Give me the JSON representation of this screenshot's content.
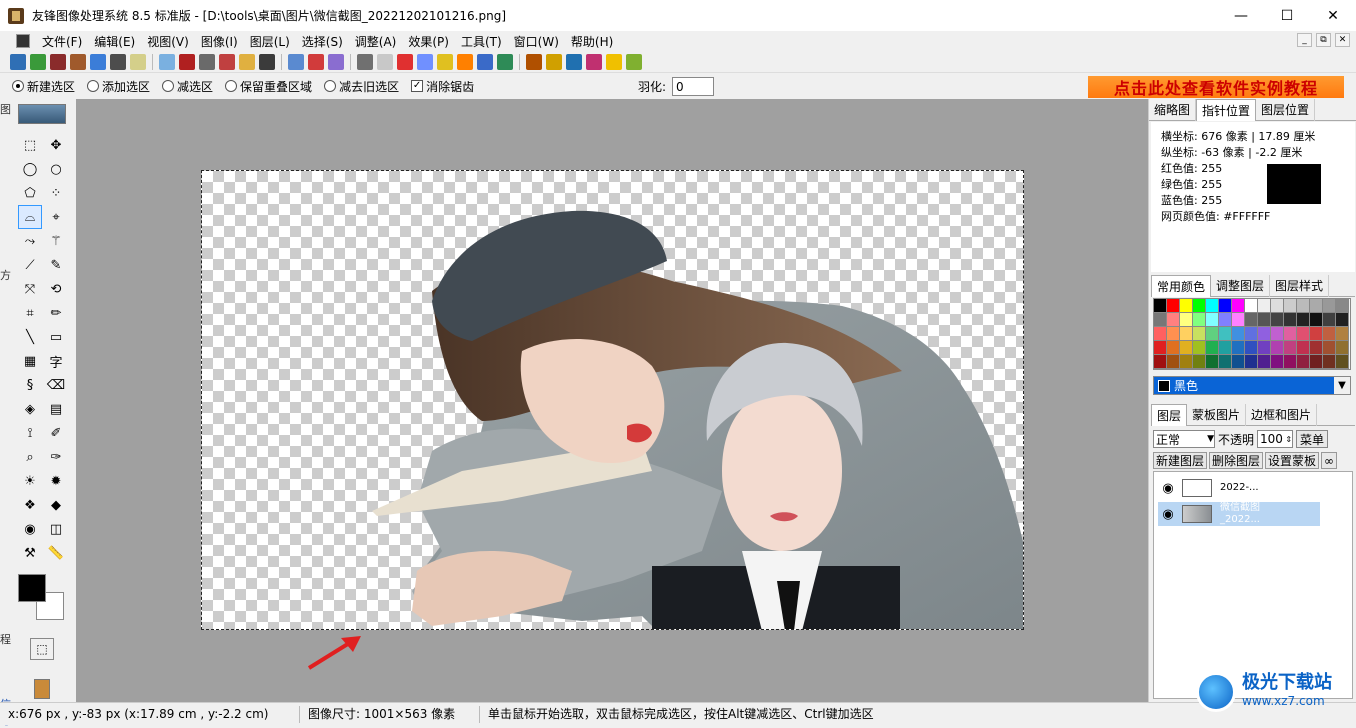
{
  "window": {
    "title": "友锋图像处理系统 8.5 标准版 - [D:\\tools\\桌面\\图片\\微信截图_20221202101216.png]",
    "controls": [
      "—",
      "☐",
      "✕"
    ]
  },
  "menu": [
    "文件(F)",
    "编辑(E)",
    "视图(V)",
    "图像(I)",
    "图层(L)",
    "选择(S)",
    "调整(A)",
    "效果(P)",
    "工具(T)",
    "窗口(W)",
    "帮助(H)"
  ],
  "mdi_controls": [
    "_",
    "⧉",
    "✕"
  ],
  "toolbar": {
    "colors": [
      "#2f6fb5",
      "#3a9a3a",
      "#8a2b2b",
      "#a05a2c",
      "#3b7dd8",
      "#4d4d4d",
      "#d4cf8a",
      "#7ab0e0",
      "#b02020",
      "#6a6a6a",
      "#c04040",
      "#e0b040",
      "#3b3b3b",
      "#5a8ad0",
      "#d13b3b",
      "#8a6dd0",
      "#707070",
      "#c8c8c8",
      "#e03030",
      "#7090ff",
      "#e0c020",
      "#ff8000",
      "#3a6ac8",
      "#2e8b57",
      "#b05000",
      "#d0a000",
      "#2070b0",
      "#c03070",
      "#f0c000",
      "#80b030"
    ]
  },
  "options": {
    "modes": [
      "新建选区",
      "添加选区",
      "减选区",
      "保留重叠区域",
      "减去旧选区"
    ],
    "selected_mode": 0,
    "antialias_label": "消除锯齿",
    "antialias_checked": true,
    "feather_label": "羽化:",
    "feather_value": "0"
  },
  "ad_banner": "点击此处查看软件实例教程",
  "left_strip_text": [
    "图",
    "方",
    "程",
    "信号"
  ],
  "tools": [
    {
      "name": "rect-select-tool",
      "glyph": "⬚"
    },
    {
      "name": "move-tool",
      "glyph": "✥"
    },
    {
      "name": "ellipse-select-tool",
      "glyph": "◯"
    },
    {
      "name": "circle-select-tool",
      "glyph": "○"
    },
    {
      "name": "polygon-select-tool",
      "glyph": "⬠"
    },
    {
      "name": "magic-select-tool",
      "glyph": "⁘"
    },
    {
      "name": "lasso-tool",
      "glyph": "⌓",
      "selected": true
    },
    {
      "name": "magnetic-lasso-tool",
      "glyph": "⌖"
    },
    {
      "name": "path-tool",
      "glyph": "⤳"
    },
    {
      "name": "magic-wand-tool",
      "glyph": "⚚"
    },
    {
      "name": "line-brush-tool",
      "glyph": "⟋"
    },
    {
      "name": "smudge-tool",
      "glyph": "✎"
    },
    {
      "name": "transform-tool",
      "glyph": "⤧"
    },
    {
      "name": "rotate-tool",
      "glyph": "⟲"
    },
    {
      "name": "crop-tool",
      "glyph": "⌗"
    },
    {
      "name": "pencil-tool",
      "glyph": "✏"
    },
    {
      "name": "line-tool",
      "glyph": "╲"
    },
    {
      "name": "rectangle-tool",
      "glyph": "▭"
    },
    {
      "name": "image-tool",
      "glyph": "▦"
    },
    {
      "name": "text-tool",
      "glyph": "字"
    },
    {
      "name": "bezier-tool",
      "glyph": "§"
    },
    {
      "name": "eraser-tool",
      "glyph": "⌫"
    },
    {
      "name": "fill-tool",
      "glyph": "◈"
    },
    {
      "name": "gradient-tool",
      "glyph": "▤"
    },
    {
      "name": "eyedropper-tool",
      "glyph": "⟟"
    },
    {
      "name": "brush-tool",
      "glyph": "✐"
    },
    {
      "name": "zoom-tool",
      "glyph": "⌕"
    },
    {
      "name": "highlight-tool",
      "glyph": "✑"
    },
    {
      "name": "brighten-tool",
      "glyph": "☀"
    },
    {
      "name": "darken-tool",
      "glyph": "✹"
    },
    {
      "name": "sponge-tool",
      "glyph": "❖"
    },
    {
      "name": "sharpen-tool",
      "glyph": "◆"
    },
    {
      "name": "red-eye-tool",
      "glyph": "◉"
    },
    {
      "name": "frame-tool",
      "glyph": "◫"
    },
    {
      "name": "stamp-tool",
      "glyph": "⚒"
    },
    {
      "name": "ruler-tool",
      "glyph": "📏"
    }
  ],
  "canvas": {
    "bg": "#a0a0a0"
  },
  "right_panel": {
    "info_tabs": [
      "缩略图",
      "指针位置",
      "图层位置"
    ],
    "active_info_tab": 1,
    "info_rows": [
      "横坐标: 676 像素 | 17.89 厘米",
      "纵坐标: -63 像素 | -2.2 厘米",
      "红色值: 255",
      "绿色值: 255",
      "蓝色值: 255",
      "网页颜色值: #FFFFFF"
    ],
    "color_tabs": [
      "常用颜色",
      "调整图层",
      "图层样式"
    ],
    "active_color_tab": 0,
    "palette": [
      "#000000",
      "#ff0000",
      "#ffff00",
      "#00ff00",
      "#00ffff",
      "#0000ff",
      "#ff00ff",
      "#ffffff",
      "#eeeeee",
      "#dddddd",
      "#cccccc",
      "#bbbbbb",
      "#aaaaaa",
      "#999999",
      "#888888",
      "#777777",
      "#ff8080",
      "#ffff80",
      "#80ff80",
      "#80ffff",
      "#8080ff",
      "#ff80ff",
      "#666666",
      "#555555",
      "#444444",
      "#333333",
      "#222222",
      "#111111",
      "#404040",
      "#202020",
      "#ff6060",
      "#ff9050",
      "#ffd060",
      "#c8e060",
      "#60d080",
      "#40c0c0",
      "#4090e0",
      "#6070e0",
      "#9060e0",
      "#c060d0",
      "#e060a0",
      "#e05070",
      "#d04040",
      "#c06040",
      "#b08040",
      "#e02020",
      "#e07020",
      "#e0b020",
      "#a0c020",
      "#20b050",
      "#20a0a0",
      "#2070c0",
      "#3050c0",
      "#7040c0",
      "#b040b0",
      "#c04080",
      "#c03050",
      "#a03030",
      "#a05030",
      "#907030",
      "#a01010",
      "#a05010",
      "#a08010",
      "#708010",
      "#107030",
      "#107070",
      "#105090",
      "#203090",
      "#502090",
      "#801080",
      "#901060",
      "#902040",
      "#702020",
      "#703020",
      "#605020"
    ],
    "selected_color": {
      "label": "黑色",
      "value": "#000000"
    },
    "layer_tabs": [
      "图层",
      "蒙板图片",
      "边框和图片"
    ],
    "active_layer_tab": 0,
    "blend_mode": "正常",
    "opacity_label": "不透明",
    "opacity_value": "100",
    "menu_button": "菜单",
    "layer_buttons": [
      "新建图层",
      "删除图层",
      "设置蒙板",
      "∞"
    ],
    "layers": [
      {
        "name": "2022-...",
        "selected": false
      },
      {
        "name": "微信截图\n_2022...",
        "selected": true
      }
    ]
  },
  "status": {
    "coords": "x:676 px , y:-83 px (x:17.89 cm , y:-2.2 cm)",
    "size": "图像尺寸: 1001×563 像素",
    "hint": "单击鼠标开始选取，双击鼠标完成选区，按住Alt键减选区、Ctrl键加选区"
  },
  "watermark": {
    "title": "极光下载站",
    "url": "www.xz7.com"
  }
}
